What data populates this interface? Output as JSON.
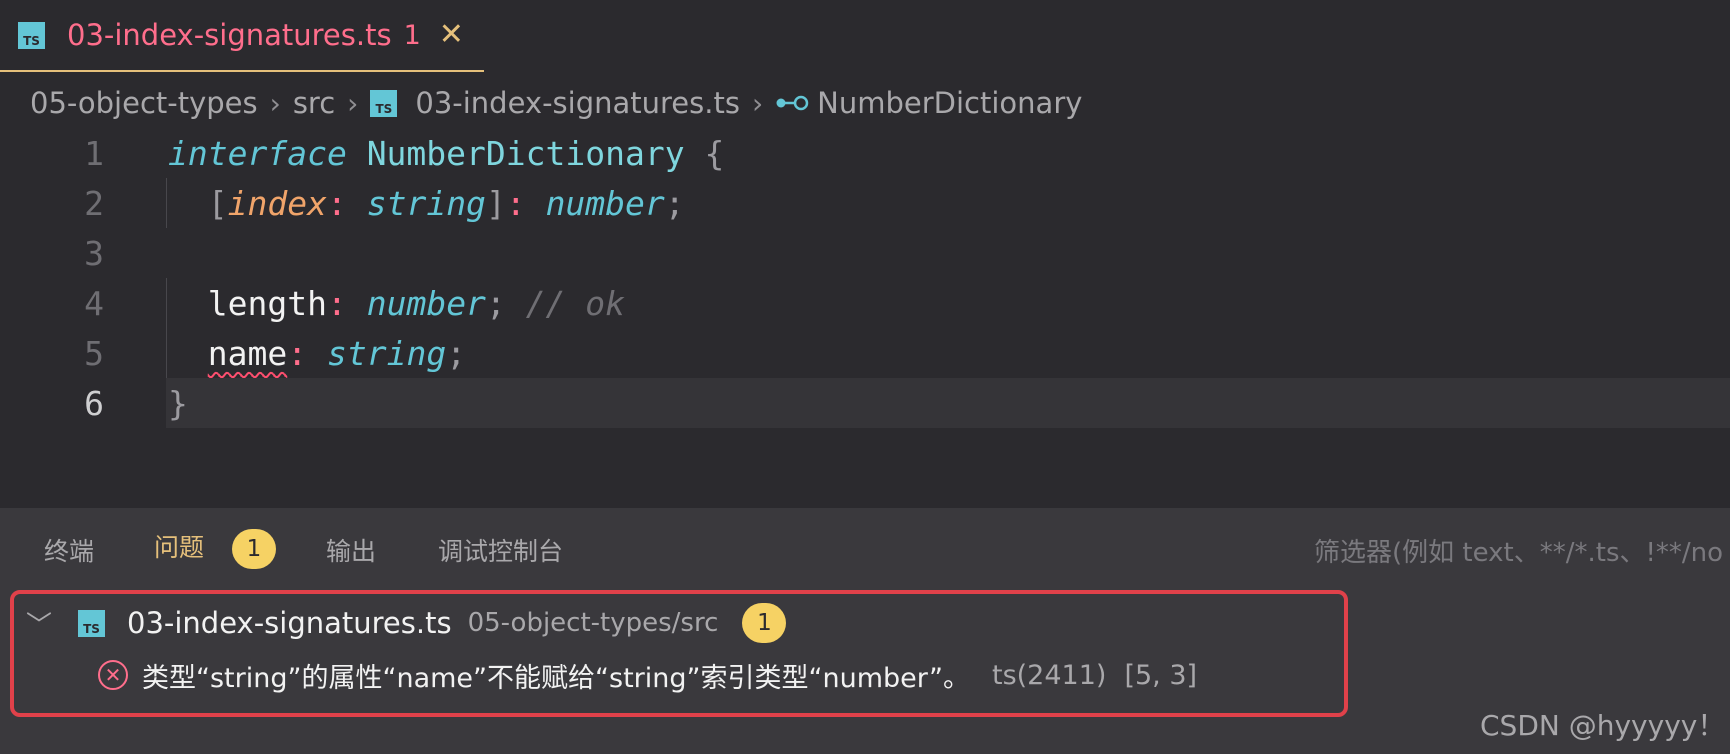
{
  "tab": {
    "icon_label": "TS",
    "title": "03-index-signatures.ts",
    "problem_count": "1",
    "close_glyph": "✕"
  },
  "breadcrumb": {
    "folder": "05-object-types",
    "subfolder": "src",
    "icon_label": "TS",
    "file": "03-index-signatures.ts",
    "symbol": "NumberDictionary",
    "separator": "›"
  },
  "editor": {
    "current_line": 6,
    "lines": [
      {
        "num": "1"
      },
      {
        "num": "2"
      },
      {
        "num": "3"
      },
      {
        "num": "4"
      },
      {
        "num": "5"
      },
      {
        "num": "6"
      }
    ],
    "tokens": {
      "l1_kw": "interface",
      "l1_name": "NumberDictionary",
      "l1_brace": "{",
      "l2_open": "[",
      "l2_param": "index",
      "l2_colon1": ":",
      "l2_type1": "string",
      "l2_close": "]",
      "l2_colon2": ":",
      "l2_type2": "number",
      "l2_semi": ";",
      "l4_prop": "length",
      "l4_colon": ":",
      "l4_type": "number",
      "l4_semi": ";",
      "l4_comment": "// ok",
      "l5_prop": "name",
      "l5_colon": ":",
      "l5_type": "string",
      "l5_semi": ";",
      "l6_brace": "}"
    }
  },
  "panel": {
    "tabs": [
      {
        "label": "终端"
      },
      {
        "label": "问题",
        "badge": "1"
      },
      {
        "label": "输出"
      },
      {
        "label": "调试控制台"
      }
    ],
    "filter_placeholder": "筛选器(例如 text、**/*.ts、!**/no",
    "problem_group": {
      "chevron": "﹀",
      "icon_label": "TS",
      "file": "03-index-signatures.ts",
      "path": "05-object-types/src",
      "count": "1"
    },
    "problem": {
      "icon_glyph": "✕",
      "message": "类型“string”的属性“name”不能赋给“string”索引类型“number”。",
      "code": "ts(2411)",
      "position": "[5, 3]"
    }
  },
  "watermark": "CSDN @hyyyyy！",
  "colors": {
    "active_tab_text": "#ff6e8c",
    "tab_underline": "#e5c07b",
    "badge": "#f6d264",
    "error": "#e0414a",
    "ts_icon": "#63c6d6"
  }
}
